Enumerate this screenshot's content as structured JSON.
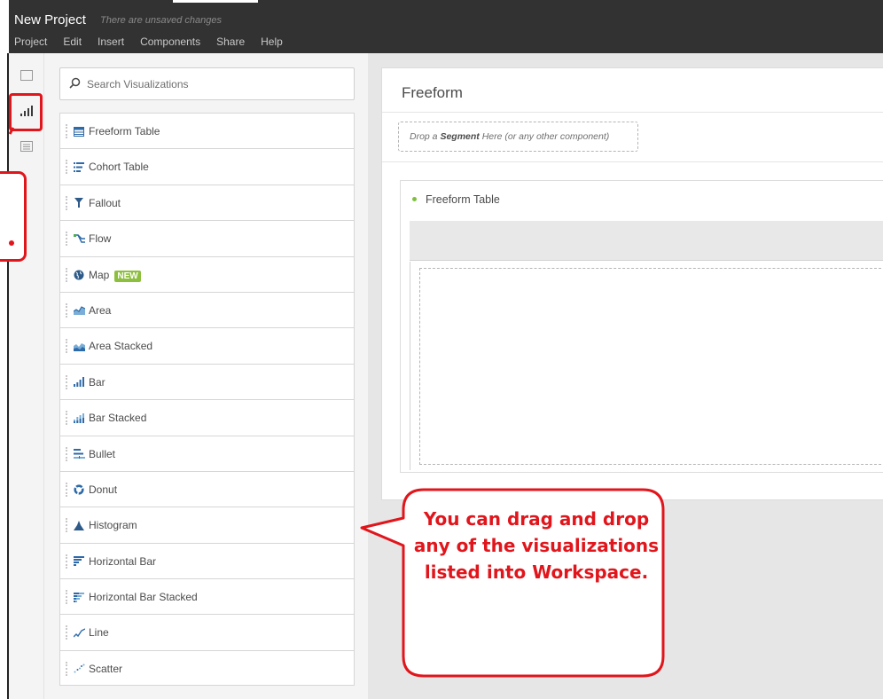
{
  "app": {
    "title": "New Project",
    "unsaved_note": "There are unsaved changes"
  },
  "menu": [
    "Project",
    "Edit",
    "Insert",
    "Components",
    "Share",
    "Help"
  ],
  "rail": {
    "icons": [
      "panel-icon",
      "visualizations-icon",
      "table-rows-icon"
    ],
    "selected": "visualizations-icon"
  },
  "search": {
    "placeholder": "Search Visualizations",
    "value": ""
  },
  "visualizations": [
    {
      "label": "Freeform Table",
      "icon": "freeform-table-icon"
    },
    {
      "label": "Cohort Table",
      "icon": "cohort-table-icon"
    },
    {
      "label": "Fallout",
      "icon": "fallout-icon"
    },
    {
      "label": "Flow",
      "icon": "flow-icon"
    },
    {
      "label": "Map",
      "icon": "map-icon",
      "badge": "NEW"
    },
    {
      "label": "Area",
      "icon": "area-icon"
    },
    {
      "label": "Area Stacked",
      "icon": "area-stacked-icon"
    },
    {
      "label": "Bar",
      "icon": "bar-icon"
    },
    {
      "label": "Bar Stacked",
      "icon": "bar-stacked-icon"
    },
    {
      "label": "Bullet",
      "icon": "bullet-icon"
    },
    {
      "label": "Donut",
      "icon": "donut-icon"
    },
    {
      "label": "Histogram",
      "icon": "histogram-icon"
    },
    {
      "label": "Horizontal Bar",
      "icon": "horizontal-bar-icon"
    },
    {
      "label": "Horizontal Bar Stacked",
      "icon": "horizontal-bar-stacked-icon"
    },
    {
      "label": "Line",
      "icon": "line-icon"
    },
    {
      "label": "Scatter",
      "icon": "scatter-icon"
    }
  ],
  "workspace": {
    "panel_title": "Freeform",
    "segment_drop": {
      "prefix": "Drop a ",
      "bold": "Segment",
      "suffix": " Here (or any other component)"
    },
    "visualization_title": "Freeform Table"
  },
  "annotation": {
    "callout_text": "You can drag and drop any of the visualizations listed into Workspace.",
    "color": "#e0161c"
  },
  "colors": {
    "topbar": "#323232",
    "badge": "#8dbf3f",
    "status_dot": "#7fbf3f"
  }
}
